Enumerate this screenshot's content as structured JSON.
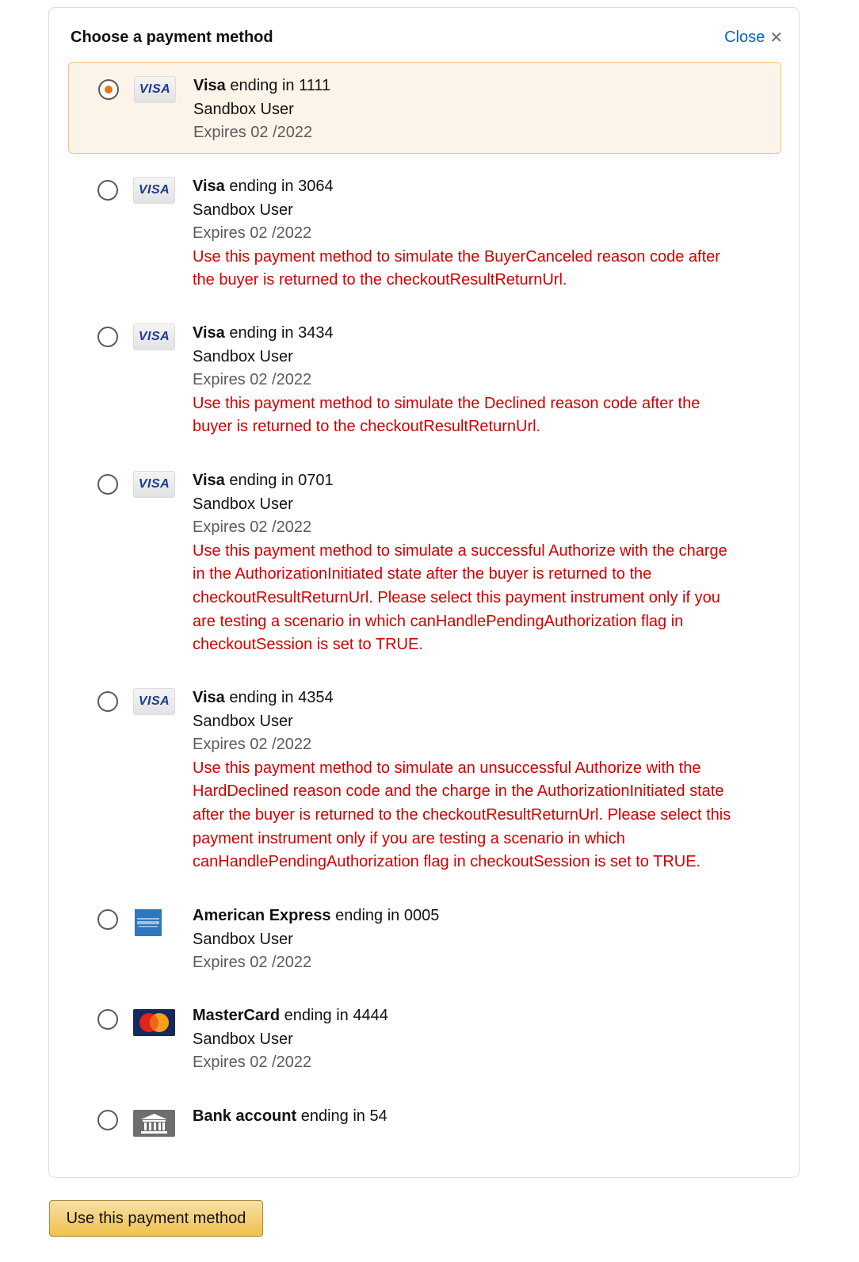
{
  "dialog": {
    "title": "Choose a payment method",
    "close_label": "Close",
    "close_glyph": "✕"
  },
  "options": [
    {
      "brand": "Visa",
      "ending": " ending in 1111",
      "name": "Sandbox User",
      "expires": "Expires 02 /2022",
      "note": "",
      "selected": true,
      "icon": "visa-card-icon",
      "logo_text": "VISA"
    },
    {
      "brand": "Visa",
      "ending": " ending in 3064",
      "name": "Sandbox User",
      "expires": "Expires 02 /2022",
      "note": [
        "Use this payment method to simulate the BuyerCanceled reason code after",
        "the buyer is returned to the checkoutResultReturnUrl."
      ],
      "selected": false,
      "icon": "visa-card-icon",
      "logo_text": "VISA"
    },
    {
      "brand": "Visa",
      "ending": " ending in 3434",
      "name": "Sandbox User",
      "expires": "Expires 02 /2022",
      "note": [
        "Use this payment method to simulate the Declined reason code after the",
        "buyer is returned to the checkoutResultReturnUrl."
      ],
      "selected": false,
      "icon": "visa-card-icon",
      "logo_text": "VISA"
    },
    {
      "brand": "Visa",
      "ending": " ending in 0701",
      "name": "Sandbox User",
      "expires": "Expires 02 /2022",
      "note": [
        "Use this payment method to simulate a successful Authorize with the charge",
        "in the AuthorizationInitiated state after the buyer is returned to the",
        "checkoutResultReturnUrl. Please select this payment instrument only if you",
        "are testing a scenario in which canHandlePendingAuthorization flag in",
        "checkoutSession is set to TRUE."
      ],
      "selected": false,
      "icon": "visa-card-icon",
      "logo_text": "VISA"
    },
    {
      "brand": "Visa",
      "ending": " ending in 4354",
      "name": "Sandbox User",
      "expires": "Expires 02 /2022",
      "note": [
        "Use this payment method to simulate an unsuccessful Authorize with the",
        "HardDeclined reason code and the charge in the AuthorizationInitiated state",
        "after the buyer is returned to the checkoutResultReturnUrl. Please select this",
        "payment instrument only if you are testing a scenario in which",
        "canHandlePendingAuthorization flag in checkoutSession is set to TRUE."
      ],
      "selected": false,
      "icon": "visa-card-icon",
      "logo_text": "VISA"
    },
    {
      "brand": "American Express",
      "ending": " ending in 0005",
      "name": "Sandbox User",
      "expires": "Expires 02 /2022",
      "note": "",
      "selected": false,
      "icon": "amex-card-icon"
    },
    {
      "brand": "MasterCard",
      "ending": " ending in 4444",
      "name": "Sandbox User",
      "expires": "Expires 02 /2022",
      "note": "",
      "selected": false,
      "icon": "mastercard-card-icon"
    },
    {
      "brand": "Bank account",
      "ending": " ending in 54",
      "name": "",
      "expires": "",
      "note": "",
      "selected": false,
      "icon": "bank-icon"
    }
  ],
  "footer": {
    "submit_label": "Use this payment method"
  },
  "colors": {
    "link": "#0066c0",
    "warning_text": "#d00000",
    "selected_bg": "#fcf4e8",
    "selected_border": "#f0c17f",
    "radio_dot": "#e47911",
    "button_bg": "#f0c14b"
  }
}
